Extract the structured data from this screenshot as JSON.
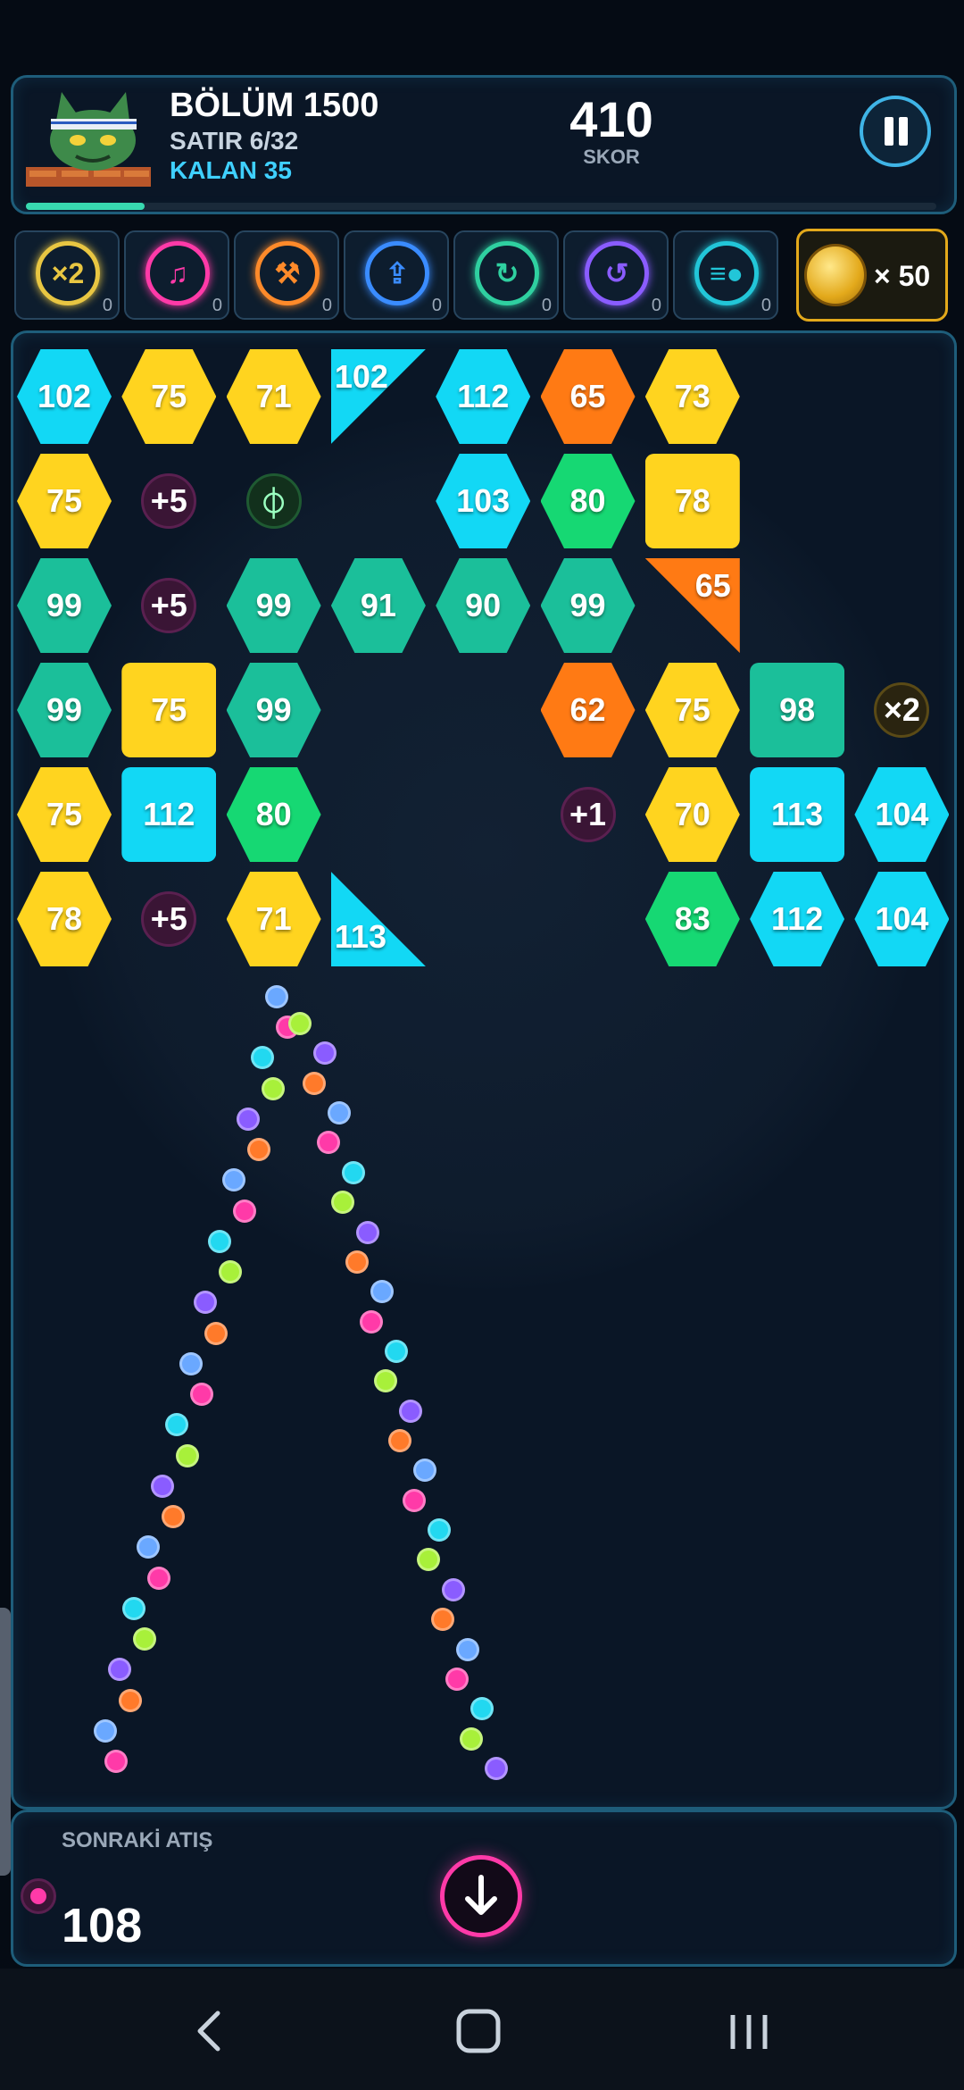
{
  "header": {
    "level": "BÖLÜM 1500",
    "row": "SATIR 6/32",
    "remaining": "KALAN 35",
    "score": "410",
    "score_label": "SKOR",
    "progress": 0.13
  },
  "powerups": [
    {
      "name": "double-ball",
      "glyph": "×2",
      "color": "#e8c642",
      "count": "0"
    },
    {
      "name": "music-note",
      "glyph": "♫",
      "color": "#ff3aa8",
      "count": "0"
    },
    {
      "name": "hammer",
      "glyph": "⚒",
      "color": "#ff8a2a",
      "count": "0"
    },
    {
      "name": "upload",
      "glyph": "⇪",
      "color": "#3a8cff",
      "count": "0"
    },
    {
      "name": "rotate",
      "glyph": "↻",
      "color": "#2fd0a0",
      "count": "0"
    },
    {
      "name": "undo",
      "glyph": "↺",
      "color": "#8a5cff",
      "count": "0"
    },
    {
      "name": "speed",
      "glyph": "≡●",
      "color": "#22c6d8",
      "count": "0"
    }
  ],
  "coins": {
    "count": "× 50"
  },
  "colors": {
    "cyan": "#12d8f5",
    "yellow": "#ffd41f",
    "orange": "#ff7a14",
    "teal": "#1bbf9a",
    "green": "#16d873"
  },
  "bricks": [
    {
      "row": 0,
      "col": 0,
      "value": "102",
      "color": "cyan",
      "shape": "hex"
    },
    {
      "row": 0,
      "col": 1,
      "value": "75",
      "color": "yellow",
      "shape": "hex"
    },
    {
      "row": 0,
      "col": 2,
      "value": "71",
      "color": "yellow",
      "shape": "hex"
    },
    {
      "row": 0,
      "col": 3,
      "value": "102",
      "color": "cyan",
      "shape": "tri-tl"
    },
    {
      "row": 0,
      "col": 4,
      "value": "112",
      "color": "cyan",
      "shape": "hex"
    },
    {
      "row": 0,
      "col": 5,
      "value": "65",
      "color": "orange",
      "shape": "hex"
    },
    {
      "row": 0,
      "col": 6,
      "value": "73",
      "color": "yellow",
      "shape": "hex"
    },
    {
      "row": 1,
      "col": 0,
      "value": "75",
      "color": "yellow",
      "shape": "hex"
    },
    {
      "row": 1,
      "col": 4,
      "value": "103",
      "color": "cyan",
      "shape": "hex"
    },
    {
      "row": 1,
      "col": 5,
      "value": "80",
      "color": "green",
      "shape": "hex"
    },
    {
      "row": 1,
      "col": 6,
      "value": "78",
      "color": "yellow",
      "shape": "square"
    },
    {
      "row": 2,
      "col": 0,
      "value": "99",
      "color": "teal",
      "shape": "hex"
    },
    {
      "row": 2,
      "col": 2,
      "value": "99",
      "color": "teal",
      "shape": "hex"
    },
    {
      "row": 2,
      "col": 3,
      "value": "91",
      "color": "teal",
      "shape": "hex"
    },
    {
      "row": 2,
      "col": 4,
      "value": "90",
      "color": "teal",
      "shape": "hex"
    },
    {
      "row": 2,
      "col": 5,
      "value": "99",
      "color": "teal",
      "shape": "hex"
    },
    {
      "row": 2,
      "col": 6,
      "value": "65",
      "color": "orange",
      "shape": "tri-tr"
    },
    {
      "row": 3,
      "col": 0,
      "value": "99",
      "color": "teal",
      "shape": "hex"
    },
    {
      "row": 3,
      "col": 1,
      "value": "75",
      "color": "yellow",
      "shape": "square"
    },
    {
      "row": 3,
      "col": 2,
      "value": "99",
      "color": "teal",
      "shape": "hex"
    },
    {
      "row": 3,
      "col": 5,
      "value": "62",
      "color": "orange",
      "shape": "hex"
    },
    {
      "row": 3,
      "col": 6,
      "value": "75",
      "color": "yellow",
      "shape": "hex"
    },
    {
      "row": 3,
      "col": 7,
      "value": "98",
      "color": "teal",
      "shape": "square"
    },
    {
      "row": 4,
      "col": 0,
      "value": "75",
      "color": "yellow",
      "shape": "hex"
    },
    {
      "row": 4,
      "col": 1,
      "value": "112",
      "color": "cyan",
      "shape": "square"
    },
    {
      "row": 4,
      "col": 2,
      "value": "80",
      "color": "green",
      "shape": "hex"
    },
    {
      "row": 4,
      "col": 6,
      "value": "70",
      "color": "yellow",
      "shape": "hex"
    },
    {
      "row": 4,
      "col": 7,
      "value": "113",
      "color": "cyan",
      "shape": "square"
    },
    {
      "row": 4,
      "col": 8,
      "value": "104",
      "color": "cyan",
      "shape": "hex"
    },
    {
      "row": 5,
      "col": 0,
      "value": "78",
      "color": "yellow",
      "shape": "hex"
    },
    {
      "row": 5,
      "col": 2,
      "value": "71",
      "color": "yellow",
      "shape": "hex"
    },
    {
      "row": 5,
      "col": 3,
      "value": "113",
      "color": "cyan",
      "shape": "tri-bl"
    },
    {
      "row": 5,
      "col": 6,
      "value": "83",
      "color": "green",
      "shape": "hex"
    },
    {
      "row": 5,
      "col": 7,
      "value": "112",
      "color": "cyan",
      "shape": "hex"
    },
    {
      "row": 5,
      "col": 8,
      "value": "104",
      "color": "cyan",
      "shape": "hex"
    }
  ],
  "pickups": [
    {
      "row": 1,
      "col": 1,
      "label": "+5"
    },
    {
      "row": 1,
      "col": 2,
      "label": "⏀",
      "kind": "laser"
    },
    {
      "row": 2,
      "col": 1,
      "label": "+5"
    },
    {
      "row": 3,
      "col": 8,
      "label": "×2",
      "kind": "double"
    },
    {
      "row": 4,
      "col": 5,
      "label": "+1"
    },
    {
      "row": 5,
      "col": 1,
      "label": "+5"
    }
  ],
  "footer": {
    "next_label": "SONRAKİ ATIŞ",
    "ball_count": "108"
  }
}
